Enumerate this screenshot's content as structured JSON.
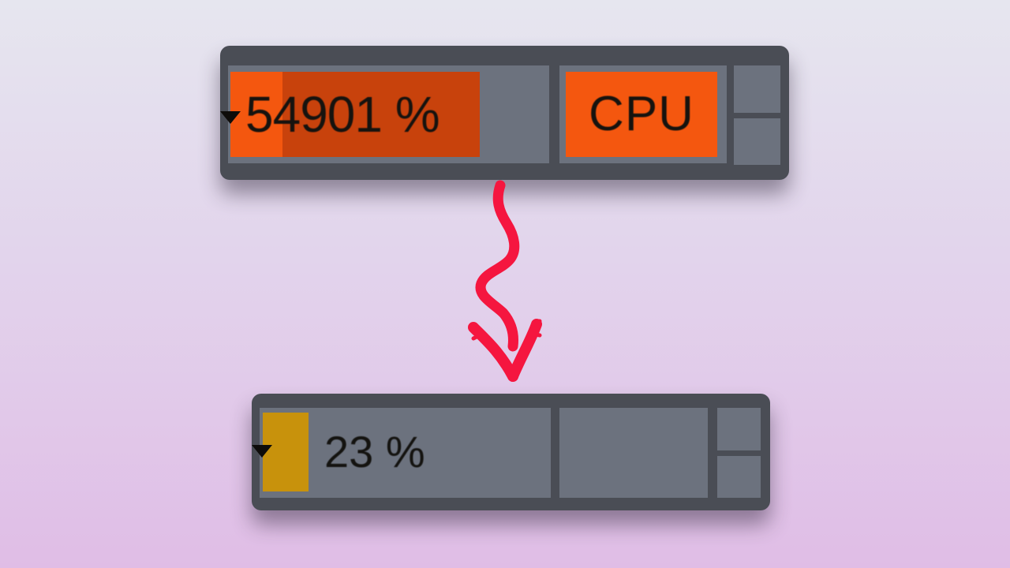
{
  "top_meter": {
    "value_text": "54901 %",
    "cpu_label": "CPU",
    "fill_color_bright": "#f4570f",
    "fill_color_dark": "#c8420c",
    "fill_fraction": 1.0,
    "dropdown_icon": "caret-down-icon"
  },
  "bottom_meter": {
    "value_text": "23 %",
    "fill_color": "#c8920c",
    "fill_fraction": 0.23,
    "dropdown_icon": "caret-down-icon"
  },
  "arrow": {
    "icon": "squiggly-down-arrow",
    "color": "#f5163f"
  },
  "panel_color": "#4a4d55",
  "cell_color": "#6c727e"
}
